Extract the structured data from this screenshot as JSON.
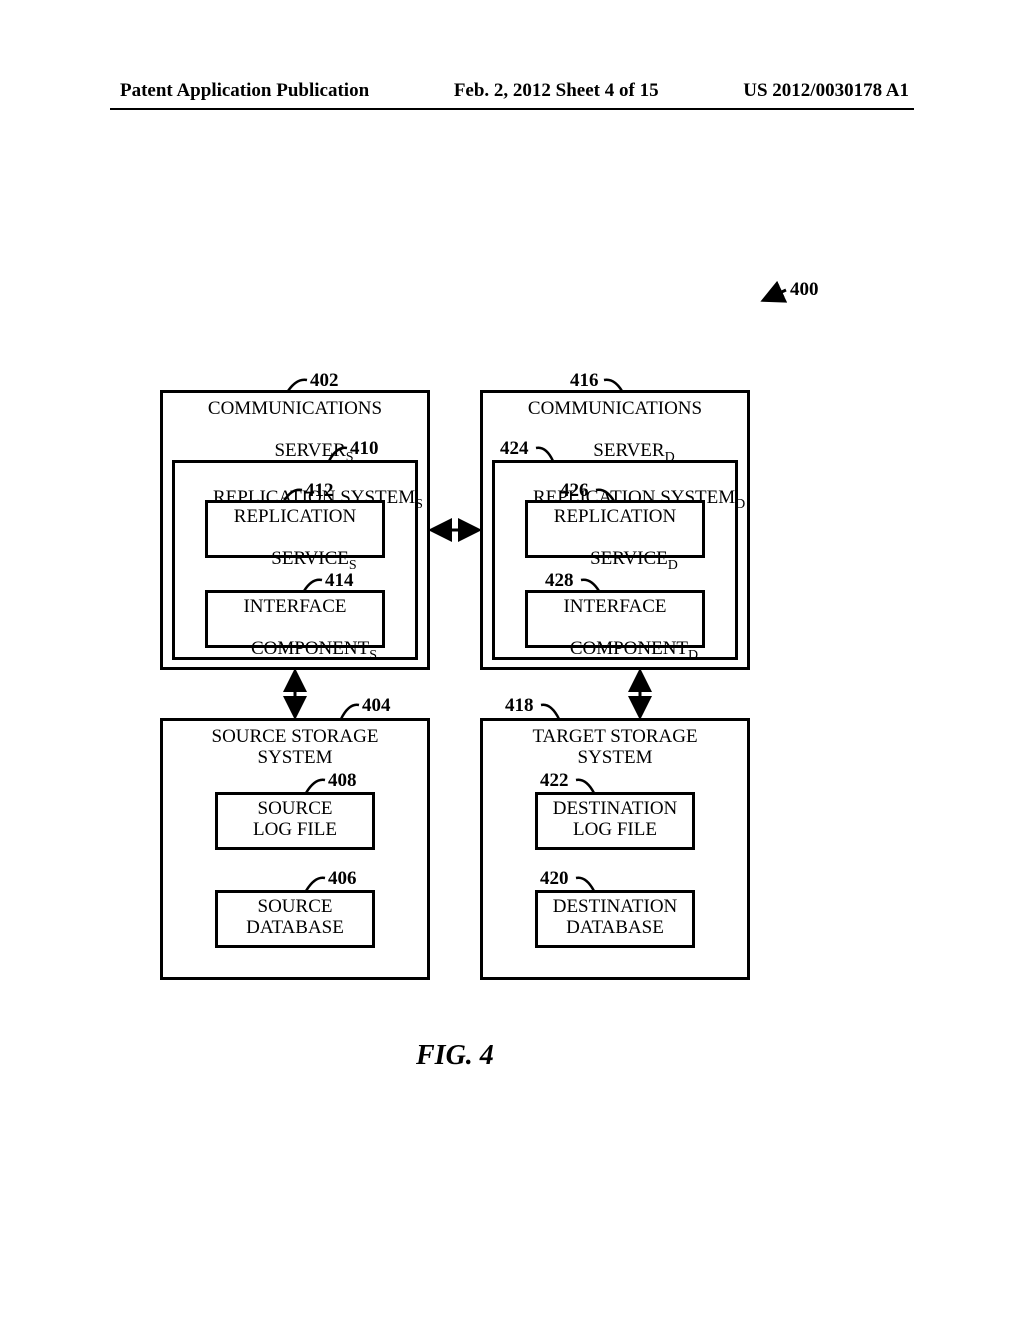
{
  "header": {
    "left": "Patent Application Publication",
    "mid": "Feb. 2, 2012  Sheet 4 of 15",
    "right": "US 2012/0030178 A1"
  },
  "refs": {
    "r400": "400",
    "r402": "402",
    "r404": "404",
    "r406": "406",
    "r408": "408",
    "r410": "410",
    "r412": "412",
    "r414": "414",
    "r416": "416",
    "r418": "418",
    "r420": "420",
    "r422": "422",
    "r424": "424",
    "r426": "426",
    "r428": "428"
  },
  "boxes": {
    "comm_s_title_l1": "COMMUNICATIONS",
    "comm_s_title_l2_pre": "SERVER",
    "comm_s_title_l2_sub": "S",
    "repl_sys_s_pre": "REPLICATION SYSTEM",
    "repl_sys_s_sub": "S",
    "repl_svc_s_l1": "REPLICATION",
    "repl_svc_s_l2_pre": "SERVICE",
    "repl_svc_s_l2_sub": "S",
    "iface_s_l1": "INTERFACE",
    "iface_s_l2_pre": "COMPONENT",
    "iface_s_l2_sub": "S",
    "source_storage_l1": "SOURCE STORAGE",
    "source_storage_l2": "SYSTEM",
    "source_log_l1": "SOURCE",
    "source_log_l2": "LOG FILE",
    "source_db_l1": "SOURCE",
    "source_db_l2": "DATABASE",
    "comm_d_title_l1": "COMMUNICATIONS",
    "comm_d_title_l2_pre": "SERVER",
    "comm_d_title_l2_sub": "D",
    "repl_sys_d_pre": "REPLICATION SYSTEM",
    "repl_sys_d_sub": "D",
    "repl_svc_d_l1": "REPLICATION",
    "repl_svc_d_l2_pre": "SERVICE",
    "repl_svc_d_l2_sub": "D",
    "iface_d_l1": "INTERFACE",
    "iface_d_l2_pre": "COMPONENT",
    "iface_d_l2_sub": "D",
    "target_storage_l1": "TARGET STORAGE",
    "target_storage_l2": "SYSTEM",
    "dest_log_l1": "DESTINATION",
    "dest_log_l2": "LOG FILE",
    "dest_db_l1": "DESTINATION",
    "dest_db_l2": "DATABASE"
  },
  "caption": "FIG. 4"
}
